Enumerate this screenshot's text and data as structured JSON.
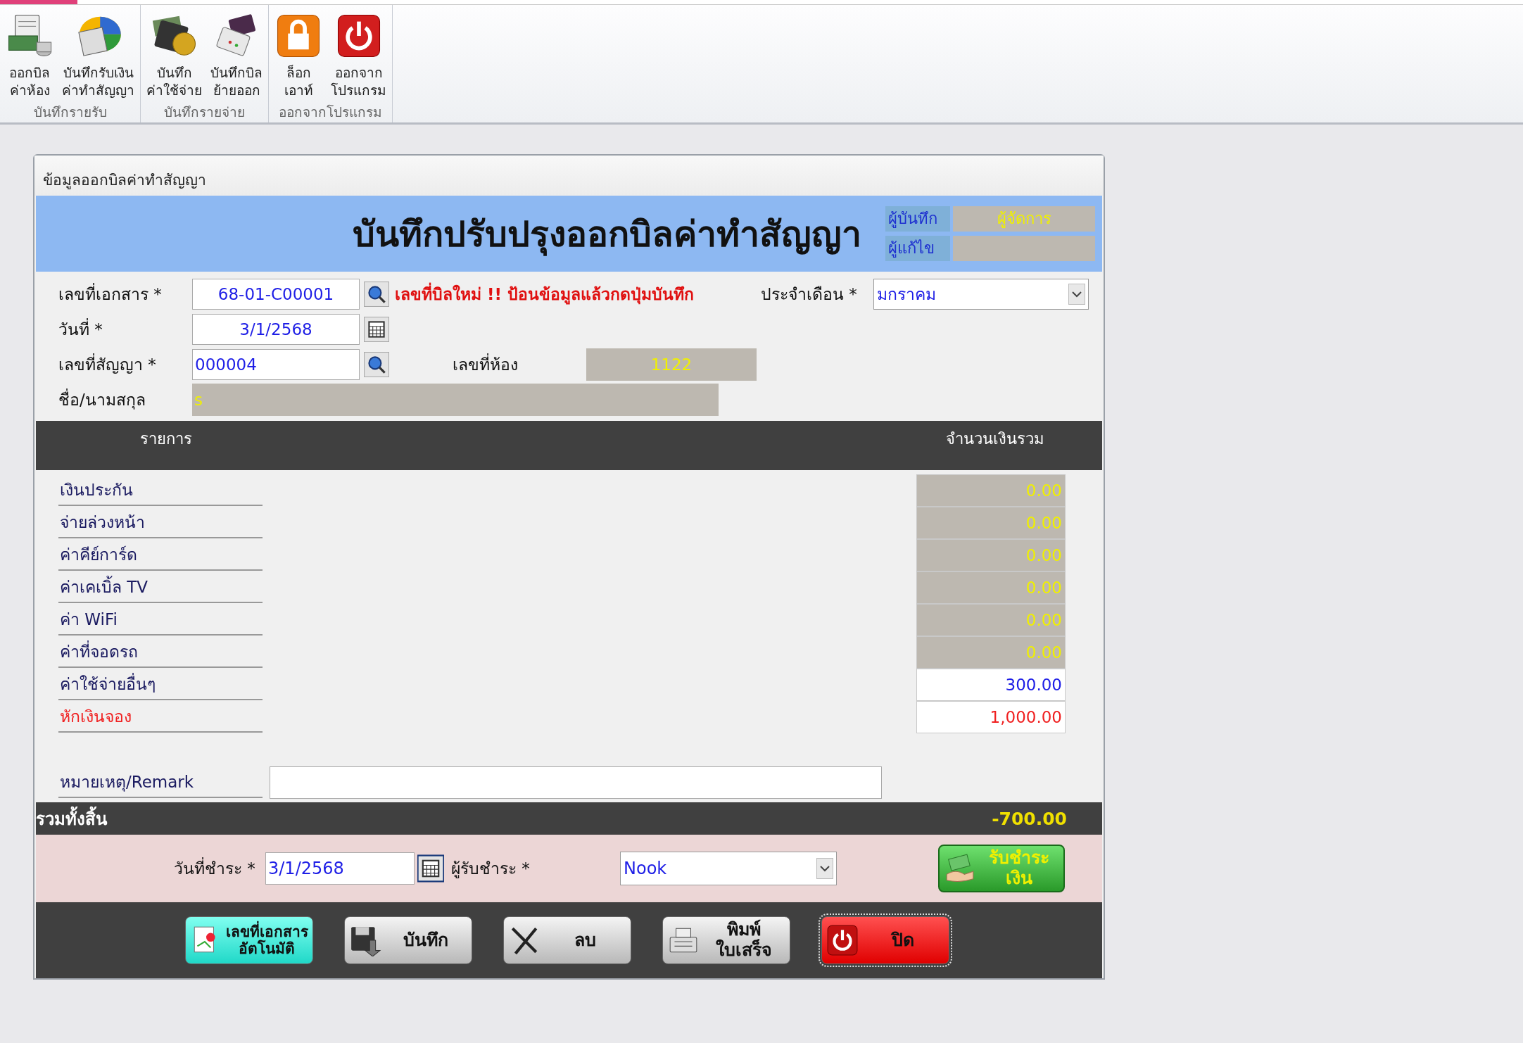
{
  "ribbon": {
    "groups": [
      {
        "label": "บันทึกรายรับ",
        "buttons": [
          {
            "kind": "bill",
            "lines": [
              "ออกบิล",
              "ค่าห้อง"
            ]
          },
          {
            "kind": "chart",
            "lines": [
              "บันทึกรับเงิน",
              "ค่าทำสัญญา"
            ]
          }
        ]
      },
      {
        "label": "บันทึกรายจ่าย",
        "buttons": [
          {
            "kind": "wallet",
            "lines": [
              "บันทึก",
              "ค่าใช้จ่าย"
            ]
          },
          {
            "kind": "register",
            "lines": [
              "บันทึกบิล",
              "ย้ายออก"
            ]
          }
        ]
      },
      {
        "label": "ออกจากโปรแกรม",
        "buttons": [
          {
            "kind": "lock",
            "lines": [
              "ล็อก",
              "เอาท์"
            ]
          },
          {
            "kind": "power",
            "lines": [
              "ออกจาก",
              "โปรแกรม"
            ]
          }
        ]
      }
    ]
  },
  "panel_title": "ข้อมูลออกบิลค่าทำสัญญา",
  "header": {
    "title": "บันทึกปรับปรุงออกบิลค่าทำสัญญา",
    "created_by": {
      "label": "ผู้บันทึก",
      "value": "ผู้จัดการ"
    },
    "edited_by": {
      "label": "ผู้แก้ไข"
    }
  },
  "fields": {
    "document_no": {
      "label": "เลขที่เอกสาร *",
      "value": "68-01-C00001"
    },
    "notice": "เลขที่บิลใหม่ !! ป้อนข้อมูลแล้วกดปุ่มบันทึก",
    "month": {
      "label": "ประจำเดือน *",
      "value": "มกราคม"
    },
    "date": {
      "label": "วันที่ *",
      "value": "3/1/2568"
    },
    "contract_no": {
      "label": "เลขที่สัญญา *",
      "value": "000004"
    },
    "room": {
      "label": "เลขที่ห้อง",
      "value": "1122"
    },
    "name": {
      "label": "ชื่อ/นามสกุล",
      "value": "s"
    }
  },
  "table": {
    "columns": [
      "รายการ",
      "จำนวนเงินรวม"
    ],
    "rows": [
      {
        "kind": "readonly",
        "label": "เงินประกัน",
        "amount": "0.00"
      },
      {
        "kind": "readonly",
        "label": "จ่ายล่วงหน้า",
        "amount": "0.00"
      },
      {
        "kind": "readonly",
        "label": "ค่าคีย์การ์ด",
        "amount": "0.00"
      },
      {
        "kind": "readonly",
        "label": "ค่าเคเบิ้ล TV",
        "amount": "0.00"
      },
      {
        "kind": "readonly",
        "label": "ค่า WiFi",
        "amount": "0.00"
      },
      {
        "kind": "readonly",
        "label": "ค่าที่จอดรถ",
        "amount": "0.00"
      },
      {
        "kind": "input",
        "label": "ค่าใช้จ่ายอื่นๆ",
        "amount": "300.00"
      },
      {
        "kind": "deduction",
        "label": "หักเงินจอง",
        "amount": "1,000.00"
      }
    ]
  },
  "remark": {
    "label": "หมายเหตุ/Remark"
  },
  "total": {
    "label": "รวมทั้งสิ้น",
    "value": "-700.00"
  },
  "payment": {
    "date": {
      "label": "วันที่ชำระ *",
      "value": "3/1/2568"
    },
    "receiver": {
      "label": "ผู้รับชำระ *",
      "value": "Nook"
    },
    "pay_button": [
      "รับชำระ",
      "เงิน"
    ]
  },
  "buttons": [
    {
      "kind": "auto",
      "lines": [
        "เลขที่เอกสาร",
        "อัตโนมัติ"
      ],
      "focused": false
    },
    {
      "kind": "save",
      "lines": [
        "บันทึก"
      ],
      "focused": false
    },
    {
      "kind": "delete",
      "lines": [
        "ลบ"
      ],
      "focused": false
    },
    {
      "kind": "print",
      "lines": [
        "พิมพ์",
        "ใบเสร็จ"
      ],
      "focused": false
    },
    {
      "kind": "close",
      "lines": [
        "ปิด"
      ],
      "focused": true
    }
  ]
}
